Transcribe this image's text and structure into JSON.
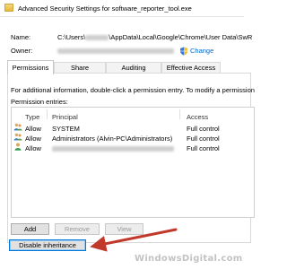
{
  "window": {
    "title": "Advanced Security Settings for software_reporter_tool.exe"
  },
  "name_row": {
    "label": "Name:",
    "value_prefix": "C:\\Users\\",
    "value_suffix": "\\AppData\\Local\\Google\\Chrome\\User Data\\SwR"
  },
  "owner_row": {
    "label": "Owner:",
    "change_label": "Change"
  },
  "tabs": [
    {
      "label": "Permissions",
      "active": true
    },
    {
      "label": "Share",
      "active": false
    },
    {
      "label": "Auditing",
      "active": false
    },
    {
      "label": "Effective Access",
      "active": false
    }
  ],
  "permissions": {
    "info_text": "For additional information, double-click a permission entry. To modify a permission",
    "entries_label": "Permission entries:",
    "columns": {
      "type": "Type",
      "principal": "Principal",
      "access": "Access"
    },
    "entries": [
      {
        "type": "Allow",
        "principal": "SYSTEM",
        "access": "Full control"
      },
      {
        "type": "Allow",
        "principal": "Administrators (Alvin-PC\\Administrators)",
        "access": "Full control"
      },
      {
        "type": "Allow",
        "principal": "",
        "access": "Full control"
      }
    ]
  },
  "buttons": {
    "add": "Add",
    "remove": "Remove",
    "view": "View",
    "disable_inheritance": "Disable inheritance"
  },
  "watermark": "WindowsDigital.com",
  "colors": {
    "link": "#0066cc",
    "arrow": "#c0392b",
    "focus_border": "#0078d7"
  }
}
